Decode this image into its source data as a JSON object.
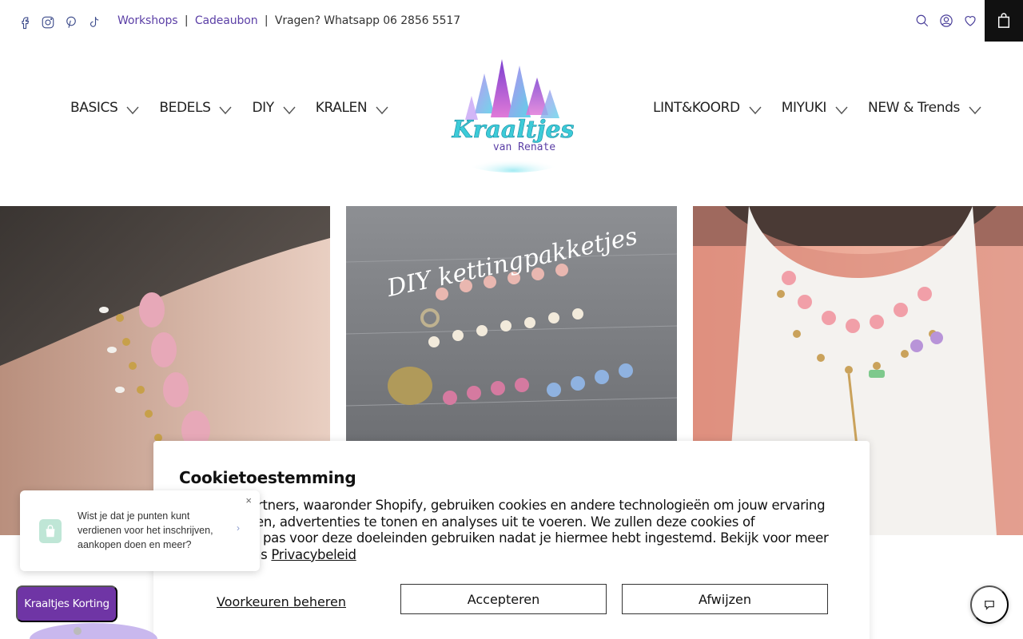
{
  "topbar": {
    "social_icons": [
      "facebook-icon",
      "instagram-icon",
      "pinterest-icon",
      "tiktok-icon"
    ],
    "announcement": {
      "workshops": "Workshops",
      "sep1": "|",
      "cadeaubon": "Cadeaubon",
      "sep2": "|",
      "whatsapp": "Vragen? Whatsapp 06 2856 5517"
    },
    "utility_icons": [
      "search-icon",
      "account-icon",
      "wishlist-icon",
      "cart-icon"
    ]
  },
  "nav": {
    "left": [
      "BASICS",
      "BEDELS",
      "DIY",
      "KRALEN"
    ],
    "right": [
      "LINT&KOORD",
      "MIYUKI",
      "NEW & Trends"
    ]
  },
  "logo": {
    "line1": "Kraaltjes",
    "line2": "van Renate"
  },
  "tiles": {
    "middle_caption": "DIY kettingpakketjes"
  },
  "cookie": {
    "title": "Cookietoestemming",
    "text_visible": "partners, waaronder Shopify, gebruiken cookies en andere technologieën om jouw ervaring",
    "text_line2": "eren, advertenties te tonen en analyses uit te voeren. We zullen deze cookies of",
    "text_line3": "en pas voor deze doeleinden gebruiken nadat je hiermee hebt ingestemd. Bekijk voor meer",
    "text_line4": "ns",
    "privacy_link": "Privacybeleid",
    "preferences": "Voorkeuren beheren",
    "accept": "Accepteren",
    "decline": "Afwijzen"
  },
  "loyalty": {
    "message": "Wist je dat je punten kunt verdienen voor het inschrijven, aankopen doen en meer?",
    "close": "×",
    "button": "Kraaltjes Korting"
  },
  "colors": {
    "accent_purple": "#6f35a5",
    "link": "#5b3fa6",
    "cart_bg": "#111111"
  }
}
